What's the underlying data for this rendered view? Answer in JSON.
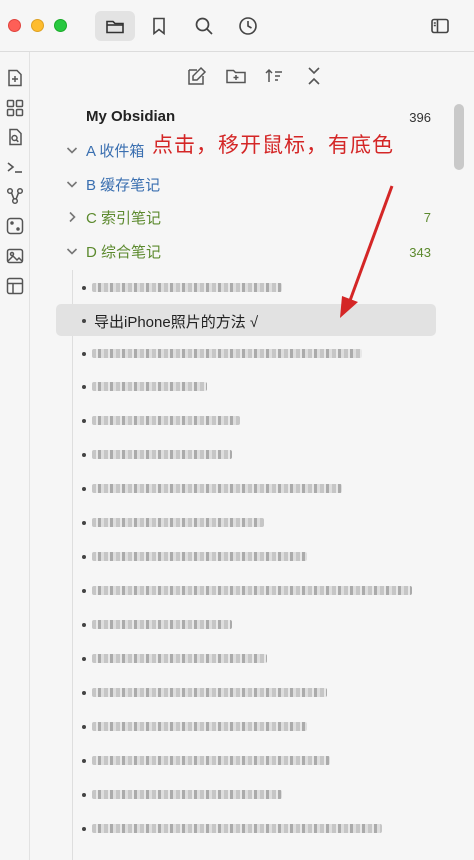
{
  "vault": {
    "name": "My Obsidian",
    "count": "396"
  },
  "folders": [
    {
      "label": "A 收件箱",
      "count": "",
      "expanded": false,
      "color": "#3a6fb0"
    },
    {
      "label": "B 缓存笔记",
      "count": "",
      "expanded": false,
      "color": "#3a6fb0"
    },
    {
      "label": "C 索引笔记",
      "count": "7",
      "expanded": false,
      "color": "#5c8a2e"
    },
    {
      "label": "D 综合笔记",
      "count": "343",
      "expanded": true,
      "color": "#5c8a2e"
    }
  ],
  "highlighted_note": {
    "label": "导出iPhone照片的方法 √"
  },
  "annotation": {
    "text": "点击，移开鼠标，有底色"
  },
  "colors": {
    "annotation": "#d42626",
    "folder_blue": "#3a6fb0",
    "folder_green": "#5c8a2e",
    "hover_bg": "#e2e2e2"
  },
  "icons": {
    "titlebar": [
      "folder-icon",
      "bookmark-icon",
      "search-icon",
      "clock-icon",
      "sidebar-toggle-icon"
    ],
    "rail": [
      "new-note-icon",
      "grid-icon",
      "file-search-icon",
      "terminal-icon",
      "graph-icon",
      "dice-icon",
      "image-icon",
      "layout-icon"
    ],
    "panel_header": [
      "new-note-icon",
      "new-folder-icon",
      "sort-icon",
      "collapse-icon"
    ]
  }
}
